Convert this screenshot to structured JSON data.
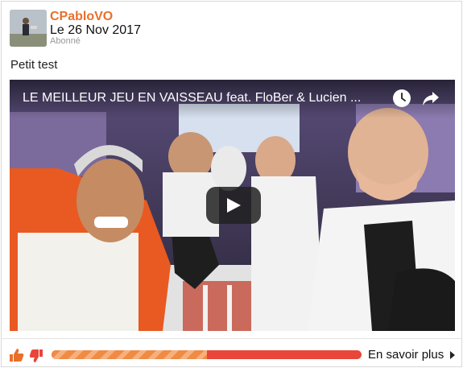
{
  "post": {
    "author": "CPabloVO",
    "date": "Le 26 Nov 2017",
    "author_status": "Abonné",
    "text": "Petit test"
  },
  "video": {
    "title": "LE MEILLEUR JEU EN VAISSEAU feat. FloBer & Lucien ...",
    "icons": [
      "clock-icon",
      "share-icon",
      "play-icon"
    ]
  },
  "footer": {
    "more_label": "En savoir plus",
    "vote_positive_ratio": 0.5,
    "colors": {
      "positive": "#f08b45",
      "negative": "#e8463a",
      "accent": "#e8702a"
    },
    "icons": [
      "thumb-up-icon",
      "thumb-down-icon",
      "chevron-right-icon"
    ]
  }
}
